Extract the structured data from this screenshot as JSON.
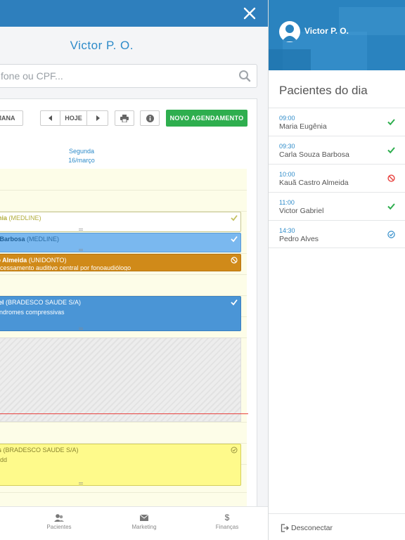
{
  "main": {
    "doctor_name": "Victor P. O.",
    "search": {
      "placeholder": "fone ou CPF..."
    },
    "toolbar": {
      "semana_label": "MANA",
      "today_label": "HOJE",
      "new_appointment_label": "NOVO AGENDAMENTO"
    },
    "day": {
      "weekday": "Segunda",
      "date": "16/março"
    },
    "appointments": [
      {
        "name": "ênia",
        "insurance": "(MEDLINE)",
        "subtitle": "",
        "status": "confirmed",
        "status_color": "#c4c060"
      },
      {
        "name": "a Barbosa",
        "insurance": "(MEDLINE)",
        "subtitle": "",
        "status": "confirmed",
        "status_color": "#ffffff"
      },
      {
        "name": "ro Almeida",
        "insurance": "(UNIDONTO)",
        "subtitle": "rocessamento auditivo central por fonoaudiólogo",
        "status": "cancelled",
        "status_color": "#ffffff"
      },
      {
        "name": "riel",
        "insurance": "(BRADESCO SAUDE S/A)",
        "subtitle": "síndromes compressivas",
        "status": "confirmed",
        "status_color": "#ffffff"
      },
      {
        "name": "es",
        "insurance": "(BRADESCO SAUDE S/A)",
        "subtitle": "Kidd",
        "status": "scheduled",
        "status_color": "#9a9540"
      }
    ],
    "bottom_nav": [
      {
        "label": "Pacientes",
        "icon": "people-icon"
      },
      {
        "label": "Marketing",
        "icon": "envelope-icon"
      },
      {
        "label": "Finanças",
        "icon": "dollar-icon"
      }
    ]
  },
  "sidebar": {
    "user_name": "Victor P. O.",
    "title": "Pacientes do dia",
    "patients": [
      {
        "time": "09:00",
        "name": "Maria Eugênia",
        "status": "confirmed",
        "status_color": "#2eae4e"
      },
      {
        "time": "09:30",
        "name": "Carla Souza Barbosa",
        "status": "confirmed",
        "status_color": "#2eae4e"
      },
      {
        "time": "10:00",
        "name": "Kauã Castro Almeida",
        "status": "cancelled",
        "status_color": "#e8423f"
      },
      {
        "time": "11:00",
        "name": "Victor Gabriel",
        "status": "confirmed",
        "status_color": "#2eae4e"
      },
      {
        "time": "14:30",
        "name": "Pedro Alves",
        "status": "scheduled",
        "status_color": "#2e8bc9"
      }
    ],
    "logout_label": "Desconectar"
  },
  "colors": {
    "brand_blue": "#2e7fbd",
    "accent_green": "#2eae4e",
    "now_line_red": "#e8423f"
  }
}
